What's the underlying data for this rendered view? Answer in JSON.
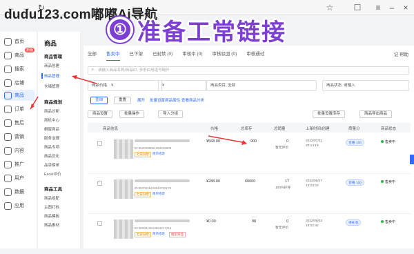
{
  "watermark": "dudu123.com嘟嘟Ai导航",
  "banner": {
    "number": "①",
    "text": "准备工常链接"
  },
  "colors": {
    "accent": "#2f6bff",
    "banner": "#7c3fd1",
    "arrow": "#e33"
  },
  "rail": [
    {
      "label": "首页",
      "icon": "home-icon"
    },
    {
      "label": "商品",
      "icon": "shop-icon",
      "badge": "新版"
    },
    {
      "label": "搜索",
      "icon": "search-icon"
    },
    {
      "label": "店铺",
      "icon": "store-icon"
    },
    {
      "label": "商品",
      "icon": "goods-icon",
      "active": true
    },
    {
      "label": "订单",
      "icon": "order-icon"
    },
    {
      "label": "售后",
      "icon": "aftersale-icon"
    },
    {
      "label": "营销",
      "icon": "marketing-icon"
    },
    {
      "label": "内容",
      "icon": "content-icon"
    },
    {
      "label": "推广",
      "icon": "promo-icon"
    },
    {
      "label": "用户",
      "icon": "user-icon"
    },
    {
      "label": "数据",
      "icon": "data-icon"
    },
    {
      "label": "应用",
      "icon": "app-icon"
    }
  ],
  "side": {
    "title": "商品",
    "sections": [
      {
        "title": "商品管理",
        "links": [
          "商品创建",
          "商品管理",
          "仓储管理"
        ],
        "active": 1
      },
      {
        "title": "商品规划",
        "links": [
          "商品诊断",
          "商机中心",
          "橱窗商品",
          "服务治理",
          "商品专项",
          "商品优化",
          "品类榜单",
          "Excel评价"
        ]
      },
      {
        "title": "商品工具",
        "links": [
          "商品组配",
          "主图打标",
          "商品模板",
          "商品素材"
        ]
      }
    ]
  },
  "tabs": [
    "全部",
    "售卖中",
    "已下架",
    "已封禁 (0)",
    "审核中 (0)",
    "审核驳回 (0)",
    "审核通过"
  ],
  "active_tab": 1,
  "help": "记 帮助",
  "search_placeholder": "请输入商品名称/商品ID, 多条ID用逗号隔开",
  "filters": [
    {
      "label": "商品价格",
      "value": "¥"
    },
    {
      "label": "",
      "value": "¥"
    },
    {
      "label": "商品类目",
      "value": "全部"
    },
    {
      "label": "商品状态",
      "value": "请输入"
    }
  ],
  "buttons": {
    "query": "查询",
    "reset": "重置",
    "more": "展开",
    "batch_sale": "批量设置库存",
    "batch_ship": "商品导出商品",
    "export": "批量操作",
    "import": "导入分组",
    "left_batch": "商品设置"
  },
  "links": {
    "ai": "批量设置商品属性",
    "exp": "查看商品分析"
  },
  "table_headers": [
    "商品信息",
    "价格",
    "总库存",
    "总销量",
    "上架时间/创建",
    "质量分",
    "商品状态"
  ],
  "rows": [
    {
      "id": "ID:3620296661393445608",
      "price": "¥568.00",
      "stock": "900",
      "sales": "0",
      "sales_note": "暂无评价",
      "date": "2022/07/21",
      "time": "20:14:15",
      "quality": "合格 100",
      "status": "售卖中",
      "tag1": "七日分享",
      "tag2": "简单修改"
    },
    {
      "id": "ID:3570211423844702179",
      "price": "¥288.00",
      "stock": "60000",
      "sales": "17",
      "sales_note": "100%好评",
      "date": "2022/06/27",
      "time": "13:23:22",
      "quality": "合格 100",
      "status": "售卖中",
      "tag1": "七日分享",
      "tag2": "简单修改"
    },
    {
      "id": "ID:3600213513844217216",
      "price": "¥0.00",
      "stock": "98",
      "sales": "0",
      "sales_note": "暂无评价",
      "date": "2022/06/02",
      "time": "19:02:42",
      "quality": "待补充",
      "status": "售卖中",
      "tag1": "七日分享",
      "tag2": "简单修改",
      "tag3": "拍卖商品"
    }
  ],
  "row_actions": "查看全部"
}
